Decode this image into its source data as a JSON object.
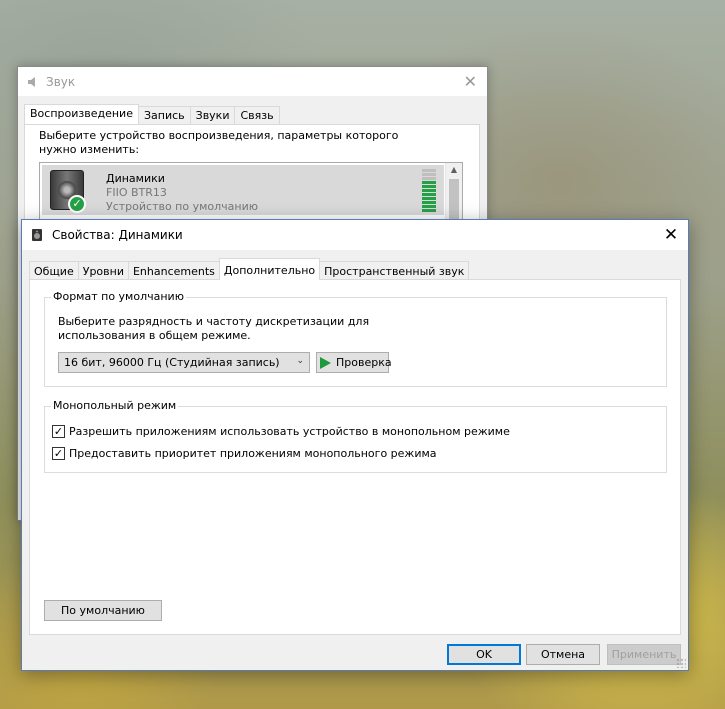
{
  "back_window": {
    "title": "Звук",
    "tabs": [
      {
        "label": "Воспроизведение",
        "active": true
      },
      {
        "label": "Запись",
        "active": false
      },
      {
        "label": "Звуки",
        "active": false
      },
      {
        "label": "Связь",
        "active": false
      }
    ],
    "description": "Выберите устройство воспроизведения, параметры которого нужно изменить:",
    "device": {
      "name": "Динамики",
      "subtitle": "FIIO BTR13",
      "status": "Устройство по умолчанию",
      "level_fraction": 0.7
    }
  },
  "front_window": {
    "title": "Свойства: Динамики",
    "tabs": [
      {
        "label": "Общие",
        "active": false
      },
      {
        "label": "Уровни",
        "active": false
      },
      {
        "label": "Enhancements",
        "active": false
      },
      {
        "label": "Дополнительно",
        "active": true
      },
      {
        "label": "Пространственный звук",
        "active": false
      }
    ],
    "default_format": {
      "legend": "Формат по умолчанию",
      "description": "Выберите разрядность и частоту дискретизации для использования в общем режиме.",
      "selected_format": "16 бит, 96000 Гц (Студийная запись)",
      "test_button": "Проверка"
    },
    "exclusive_mode": {
      "legend": "Монопольный режим",
      "allow_exclusive": {
        "label": "Разрешить приложениям использовать устройство в монопольном режиме",
        "checked": true
      },
      "give_priority": {
        "label": "Предоставить приоритет приложениям монопольного режима",
        "checked": true
      }
    },
    "restore_defaults_button": "По умолчанию",
    "buttons": {
      "ok": "OK",
      "cancel": "Отмена",
      "apply": "Применить"
    }
  },
  "colors": {
    "accent": "#0078d7",
    "play_green": "#1e9a3c",
    "meter_green": "#26a047"
  }
}
